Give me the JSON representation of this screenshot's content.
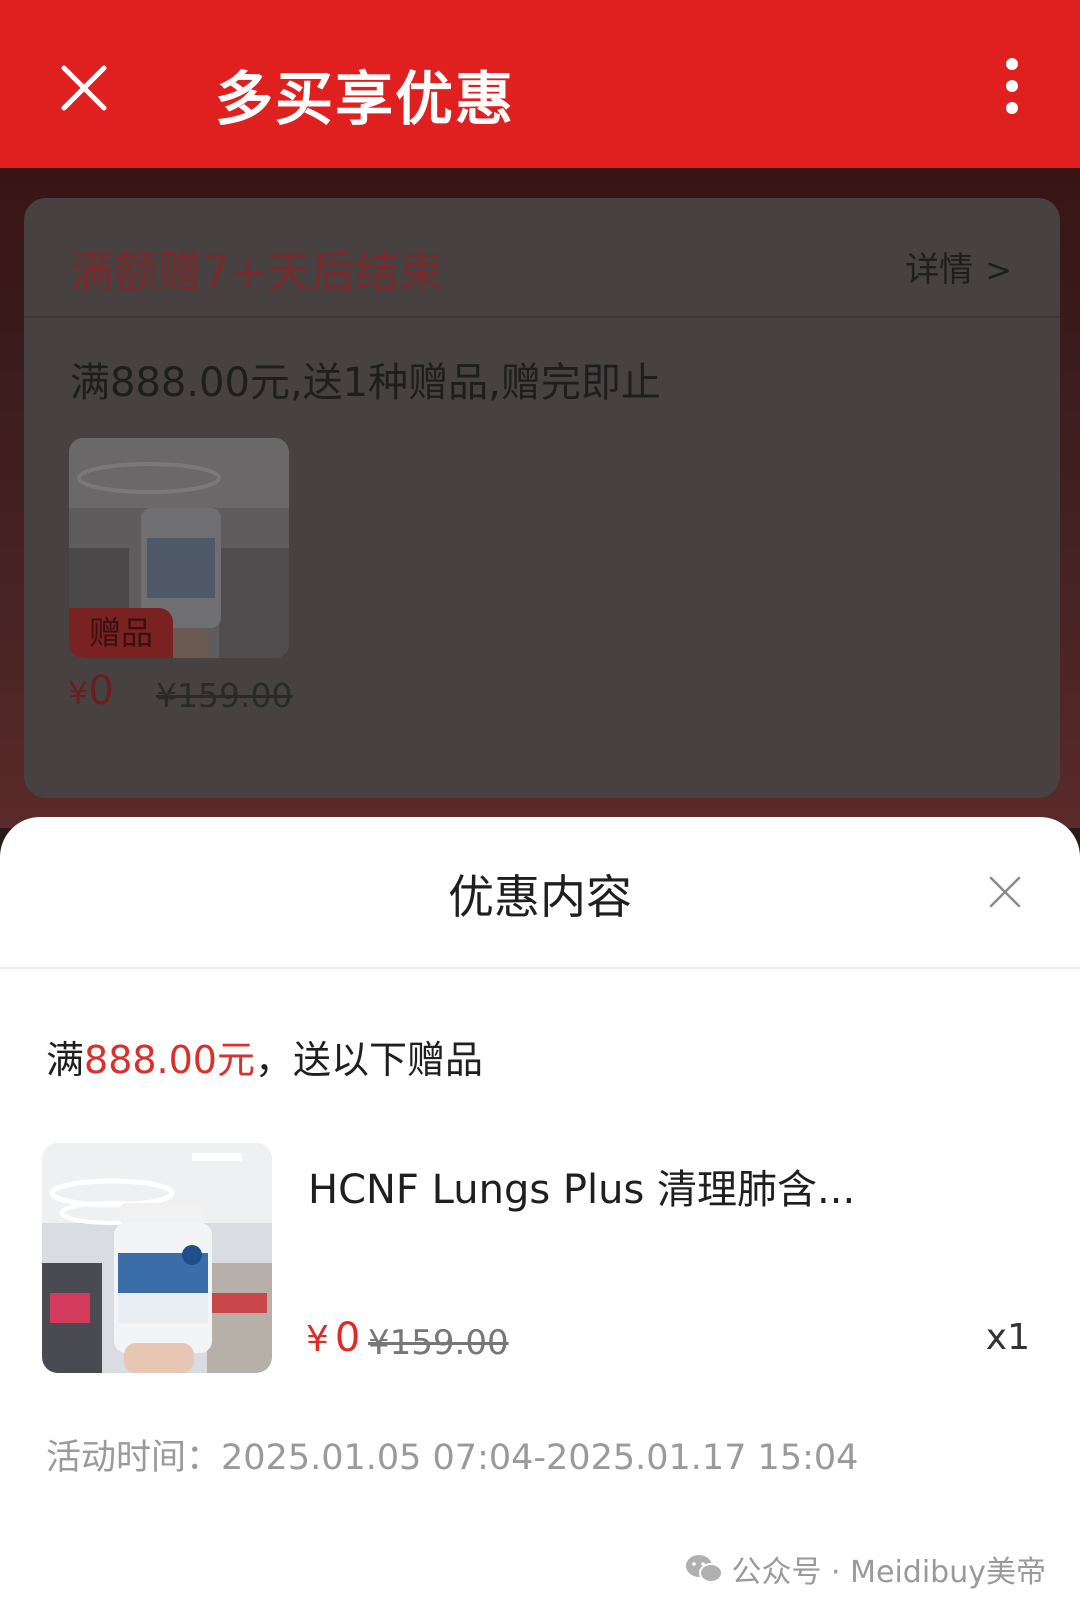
{
  "header": {
    "title": "多买享优惠",
    "close_icon": "close-icon",
    "more_icon": "more-vertical-icon",
    "bg_color": "#e0201e"
  },
  "promo_card": {
    "title": "满额赠7+天后结束",
    "detail_label": "详情",
    "condition": "满888.00元,送1种赠品,赠完即止",
    "gift_tag": "赠品",
    "price_symbol": "¥",
    "price": "0",
    "original_price": "¥159.00"
  },
  "sheet": {
    "title": "优惠内容",
    "condition_prefix": "满",
    "condition_amount": "888.00元",
    "condition_suffix": "，送以下赠品",
    "gift": {
      "name": "HCNF Lungs Plus 清理肺含...",
      "price_symbol": "¥",
      "price": "0",
      "original_price": "¥159.00",
      "quantity": "x1"
    },
    "time_label": "活动时间：",
    "time_range": "2025.01.05 07:04-2025.01.17 15:04",
    "accent_color": "#e02a25"
  },
  "watermark": {
    "text": "公众号 · Meidibuy美帝"
  }
}
